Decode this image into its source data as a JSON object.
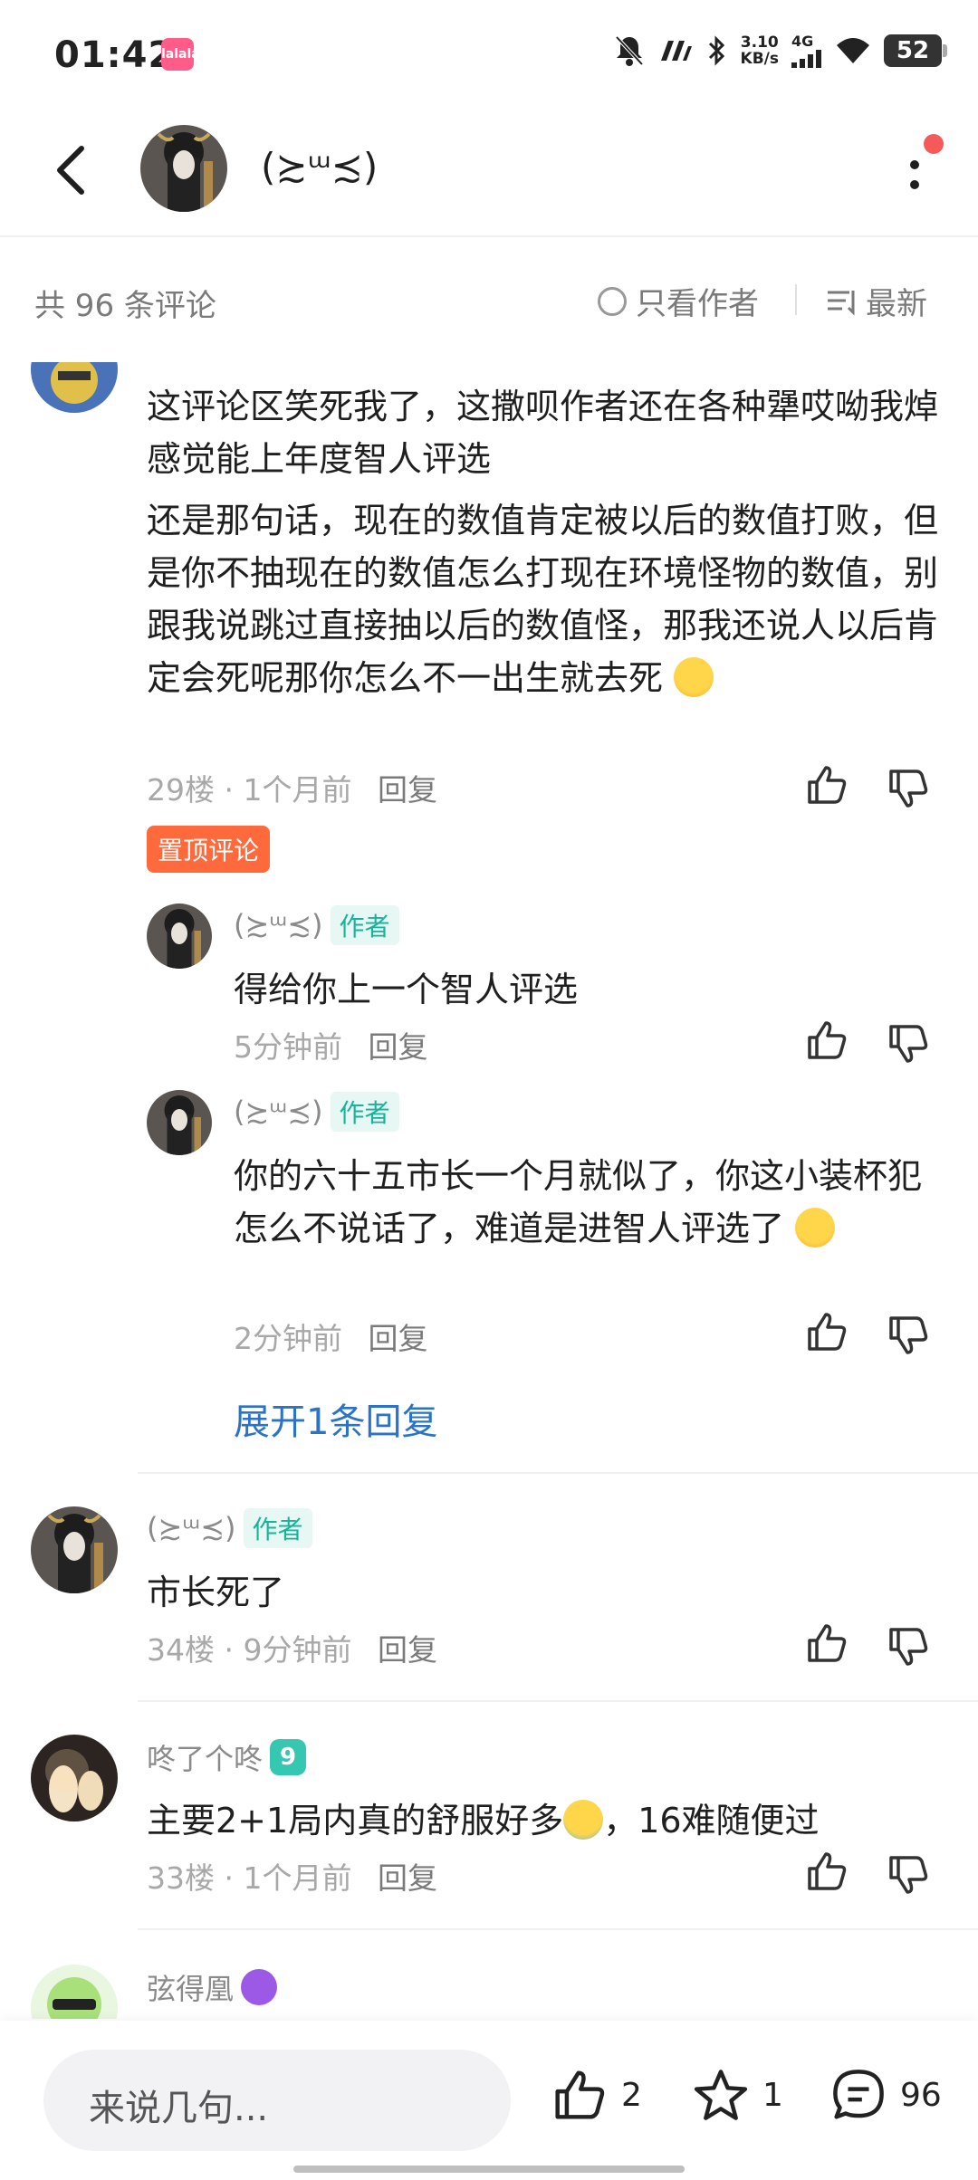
{
  "status": {
    "time": "01:42",
    "app_badge": "lalala",
    "speed_top": "3.10",
    "speed_bottom": "KB/s",
    "network": "4G",
    "battery": "52"
  },
  "header": {
    "title": "(≿ᵚ≾)"
  },
  "sortbar": {
    "count": "共 96 条评论",
    "only_author": "只看作者",
    "sort": "最新"
  },
  "comments": {
    "c29": {
      "text1": "这评论区笑死我了，这撒呗作者还在各种犟哎呦我焯感觉能上年度智人评选",
      "text2": "还是那句话，现在的数值肯定被以后的数值打败，但是你不抽现在的数值怎么打现在环境怪物的数值，别跟我说跳过直接抽以后的数值怪，那我还说人以后肯定会死呢那你怎么不一出生就去死",
      "meta": "29楼 · 1个月前",
      "reply": "回复",
      "pin_tag": "置顶评论",
      "sub1": {
        "name": "(≿ᵚ≾)",
        "tag": "作者",
        "text": "得给你上一个智人评选",
        "meta": "5分钟前",
        "reply": "回复"
      },
      "sub2": {
        "name": "(≿ᵚ≾)",
        "tag": "作者",
        "text": "你的六十五市长一个月就似了，你这小装杯犯怎么不说话了，难道是进智人评选了",
        "meta": "2分钟前",
        "reply": "回复"
      },
      "expand": "展开1条回复"
    },
    "c34": {
      "name": "(≿ᵚ≾)",
      "tag": "作者",
      "text": "市长死了",
      "meta": "34楼 · 9分钟前",
      "reply": "回复"
    },
    "c33": {
      "name": "咚了个咚",
      "level": "9",
      "text": "主要2+1局内真的舒服好多",
      "text_tail": "，16难随便过",
      "meta": "33楼 · 1个月前",
      "reply": "回复"
    },
    "c32": {
      "name": "弦得凰"
    }
  },
  "bottombar": {
    "placeholder": "来说几句...",
    "likes": "2",
    "favorites": "1",
    "comments": "96"
  },
  "colors": {
    "accent_link": "#2a73c7",
    "author_tag": "#19b39a",
    "pin_tag": "#ff6a3d"
  }
}
